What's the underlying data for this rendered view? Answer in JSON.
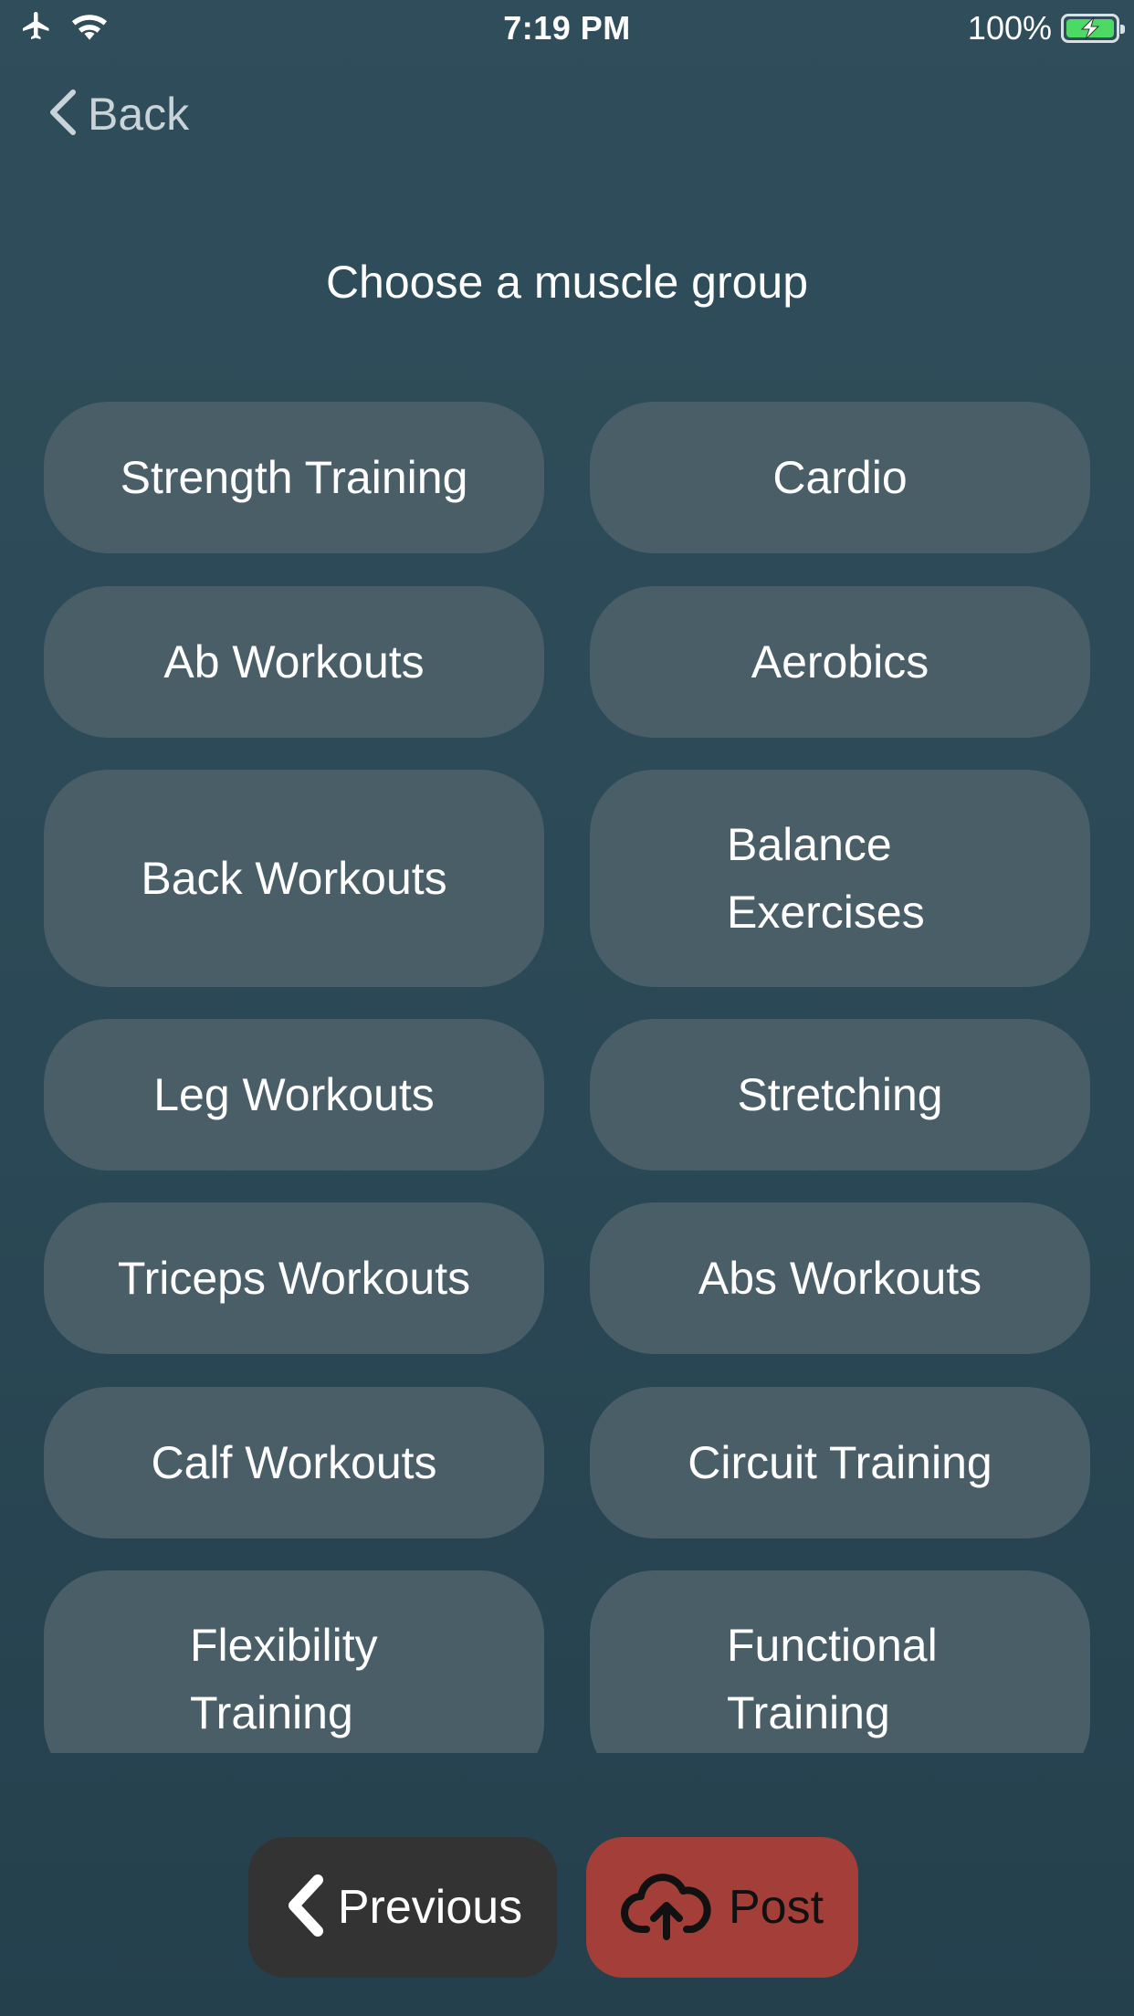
{
  "status_bar": {
    "time": "7:19 PM",
    "battery_percent": "100%",
    "icons": [
      "airplane-icon",
      "wifi-icon",
      "battery-charging-icon"
    ],
    "battery_color": "#4cd964"
  },
  "nav": {
    "back_label": "Back"
  },
  "title": "Choose a muscle group",
  "options": [
    "Strength Training",
    "Cardio",
    "Ab Workouts",
    "Aerobics",
    "Back Workouts",
    "Balance Exercises",
    "Leg Workouts",
    "Stretching",
    "Triceps Workouts",
    "Abs Workouts",
    "Calf Workouts",
    "Circuit Training",
    "Flexibility Training",
    "Functional Training"
  ],
  "footer": {
    "previous_label": "Previous",
    "post_label": "Post",
    "previous_icon": "chevron-left-icon",
    "post_icon": "cloud-upload-icon",
    "post_color": "#a33f38"
  }
}
